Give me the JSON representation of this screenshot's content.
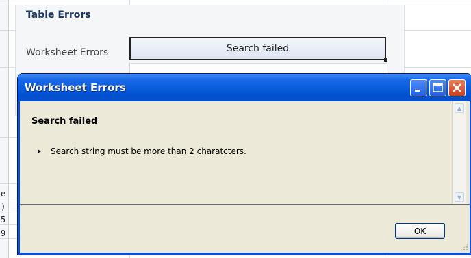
{
  "panel": {
    "title": "Table Errors",
    "worksheet_label": "Worksheet Errors",
    "search_button_label": "Search failed",
    "row_fragments": [
      "e",
      ")",
      "5",
      "9"
    ]
  },
  "dialog": {
    "title": "Worksheet Errors",
    "heading": "Search failed",
    "messages": [
      "Search string must be more than 2 charatcters."
    ],
    "ok_label": "OK",
    "icons": {
      "minimize": "minimize-icon",
      "maximize": "maximize-icon",
      "close": "close-icon"
    }
  },
  "colors": {
    "titlebar": "#0a5cdb",
    "close_button": "#cc3a1c",
    "dialog_body": "#ece9d8",
    "panel_title": "#1e3a6b"
  }
}
